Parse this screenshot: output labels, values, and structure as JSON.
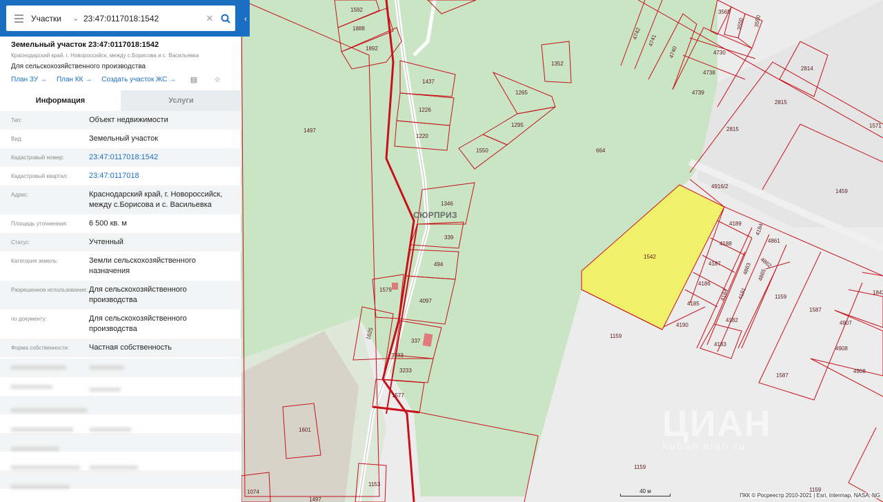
{
  "search": {
    "type_label": "Участки",
    "query": "23:47:0117018:1542"
  },
  "object": {
    "title": "Земельный участок 23:47:0117018:1542",
    "address_short": "Краснодарский край, г. Новороссийск, между с.Борисова и с. Васильевка",
    "use": "Для сельскохозяйственного производства",
    "links": [
      "План ЗУ →",
      "План КК →",
      "Создать участок ЖС →"
    ]
  },
  "tabs": [
    "Информация",
    "Услуги"
  ],
  "attributes": [
    {
      "key": "Тип:",
      "value": "Объект недвижимости"
    },
    {
      "key": "Вид:",
      "value": "Земельный участок"
    },
    {
      "key": "Кадастровый номер:",
      "value": "23:47:0117018:1542"
    },
    {
      "key": "Кадастровый квартал:",
      "value": "23:47:0117018"
    },
    {
      "key": "Адрес:",
      "value": "Краснодарский край, г. Новороссийск, между с.Борисова и с. Васильевка"
    },
    {
      "key": "Площадь уточненная:",
      "value": "6 500 кв. м"
    },
    {
      "key": "Статус:",
      "value": "Учтенный"
    },
    {
      "key": "Категория земель:",
      "value": "Земли сельскохозяйственного назначения"
    },
    {
      "key": "Разрешенное использование:",
      "value": "Для сельскохозяйственного производства"
    },
    {
      "key": "по документу:",
      "value": "Для сельскохозяйственного производства"
    },
    {
      "key": "Форма собственности:",
      "value": "Частная собственность"
    }
  ],
  "map": {
    "locality": "СЮРПРИЗ",
    "selected_parcel": "1542",
    "highlight_color": "#f1f06a",
    "parcel_stroke_color": "#c8101a",
    "forest_color": "#c9e5c4",
    "parcels": [
      "1592",
      "1888",
      "1892",
      "1437",
      "1352",
      "1265",
      "1226",
      "1295",
      "1220",
      "1550",
      "1497",
      "664",
      "1346",
      "339",
      "494",
      "4097",
      "1579",
      "1625",
      "337",
      "3233",
      "1577",
      "1601",
      "1074",
      "1153",
      "4742",
      "4741",
      "4740",
      "4730",
      "4738",
      "4739",
      "3565",
      "3550",
      "2814",
      "2815",
      "1571",
      "4916/2",
      "1459",
      "4189",
      "4188",
      "4187",
      "4186",
      "4185",
      "4190",
      "4184",
      "4181",
      "4183",
      "4182",
      "4861",
      "4862",
      "4863",
      "4865",
      "1159",
      "1587",
      "4907",
      "4908",
      "1842"
    ],
    "scale_label": "40 м",
    "attribution": "ПКК © Росреестр 2010-2021 | Esri, Intermap, NASA, NG"
  },
  "watermark": {
    "name": "ЦИАН",
    "sub": "kuban.cian.ru"
  }
}
